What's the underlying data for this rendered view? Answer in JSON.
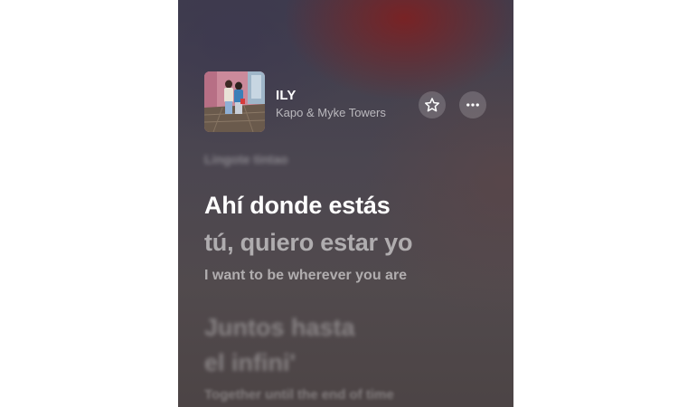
{
  "now_playing": {
    "title": "ILY",
    "artist": "Kapo & Myke Towers"
  },
  "controls": {
    "favorite_icon": "star-icon",
    "more_icon": "ellipsis-icon"
  },
  "lyrics": {
    "previous_line": "Lingote tintao",
    "current_line": "Ahí donde estás",
    "current_line_continued": "tú, quiero estar yo",
    "current_translation": "I want to be wherever you are",
    "upcoming_line_1": "Juntos hasta",
    "upcoming_line_2": "el infini'",
    "upcoming_translation": "Together until the end of time"
  },
  "colors": {
    "background_top": "#3f3d4d",
    "background_bottom": "#4c4445",
    "accent_red": "#821e1e",
    "text_primary": "#ffffff"
  }
}
